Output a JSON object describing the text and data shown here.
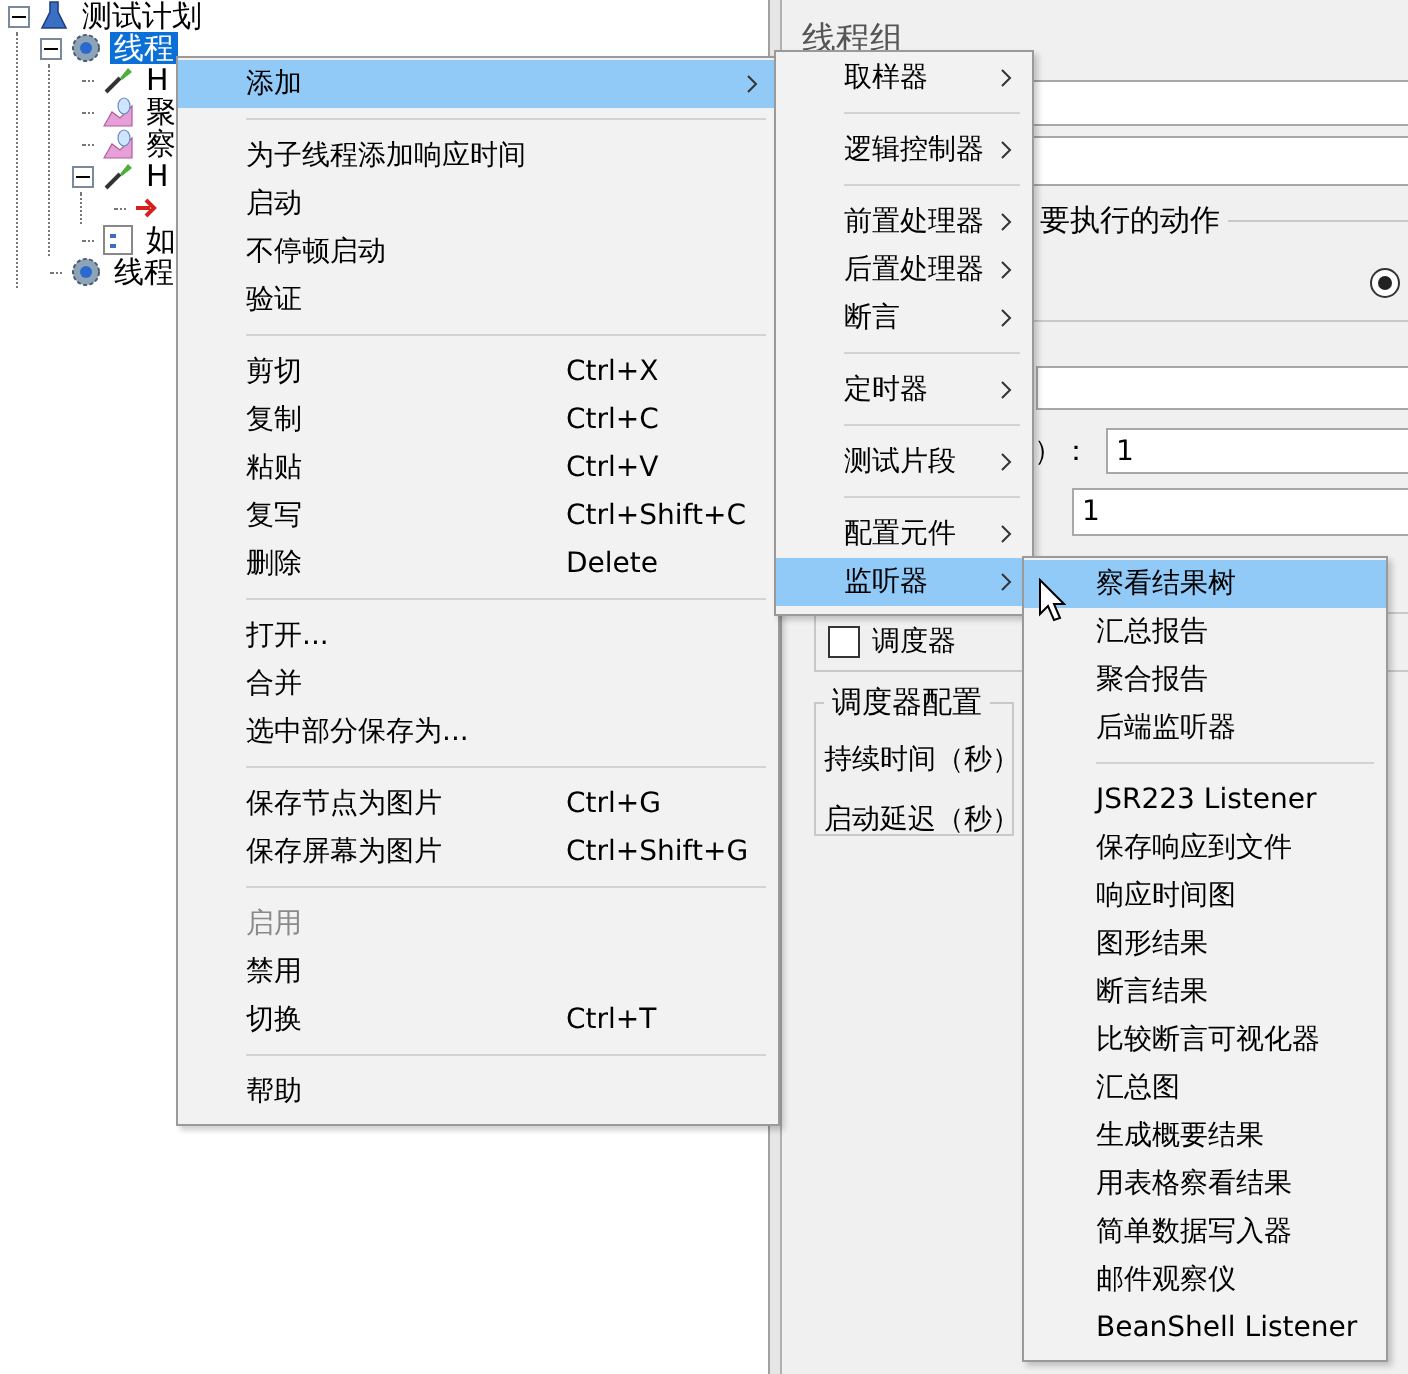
{
  "tree": [
    {
      "label": "测试计划",
      "kind": "plan",
      "selected": false,
      "expanded": true,
      "children": [
        {
          "label": "线程",
          "kind": "thread_group",
          "selected": true,
          "expanded": true,
          "children": [
            {
              "label": "H",
              "kind": "sampler",
              "selected": false
            },
            {
              "label": "聚",
              "kind": "listener",
              "selected": false
            },
            {
              "label": "察",
              "kind": "listener",
              "selected": false
            },
            {
              "label": "H",
              "kind": "sampler",
              "selected": false,
              "expanded": true,
              "children": [
                {
                  "kind": "modifier",
                  "selected": false
                }
              ]
            },
            {
              "label": "如",
              "kind": "config",
              "selected": false
            }
          ]
        },
        {
          "label": "线程",
          "kind": "thread_group",
          "selected": false
        }
      ]
    }
  ],
  "panel": {
    "title": "线程组",
    "action_legend": "要执行的动作",
    "action_radio": {
      "selected": true
    },
    "count_label": "）：",
    "count_value": "1",
    "loop_value": "1",
    "scheduler": {
      "label": "调度器",
      "checked": false
    },
    "scheduler_config": {
      "legend": "调度器配置",
      "fields": [
        "持续时间（秒）",
        "启动延迟（秒）"
      ]
    }
  },
  "context_menu": {
    "sections": [
      [
        {
          "label": "添加",
          "has_submenu": true,
          "selected": true,
          "disabled": false
        }
      ],
      [
        {
          "label": "为子线程添加响应时间",
          "selected": false,
          "disabled": false
        },
        {
          "label": "启动",
          "selected": false,
          "disabled": false
        },
        {
          "label": "不停顿启动",
          "selected": false,
          "disabled": false
        },
        {
          "label": "验证",
          "selected": false,
          "disabled": false
        }
      ],
      [
        {
          "label": "剪切",
          "shortcut": "Ctrl+X",
          "selected": false,
          "disabled": false
        },
        {
          "label": "复制",
          "shortcut": "Ctrl+C",
          "selected": false,
          "disabled": false
        },
        {
          "label": "粘贴",
          "shortcut": "Ctrl+V",
          "selected": false,
          "disabled": false
        },
        {
          "label": "复写",
          "shortcut": "Ctrl+Shift+C",
          "selected": false,
          "disabled": false
        },
        {
          "label": "删除",
          "shortcut": "Delete",
          "selected": false,
          "disabled": false
        }
      ],
      [
        {
          "label": "打开...",
          "selected": false,
          "disabled": false
        },
        {
          "label": "合并",
          "selected": false,
          "disabled": false
        },
        {
          "label": "选中部分保存为...",
          "selected": false,
          "disabled": false
        }
      ],
      [
        {
          "label": "保存节点为图片",
          "shortcut": "Ctrl+G",
          "selected": false,
          "disabled": false
        },
        {
          "label": "保存屏幕为图片",
          "shortcut": "Ctrl+Shift+G",
          "selected": false,
          "disabled": false
        }
      ],
      [
        {
          "label": "启用",
          "selected": false,
          "disabled": true
        },
        {
          "label": "禁用",
          "selected": false,
          "disabled": false
        },
        {
          "label": "切换",
          "shortcut": "Ctrl+T",
          "selected": false,
          "disabled": false
        }
      ],
      [
        {
          "label": "帮助",
          "selected": false,
          "disabled": false
        }
      ]
    ]
  },
  "add_menu": {
    "sections": [
      [
        {
          "label": "取样器",
          "has_submenu": true,
          "selected": false
        }
      ],
      [
        {
          "label": "逻辑控制器",
          "has_submenu": true,
          "selected": false
        }
      ],
      [
        {
          "label": "前置处理器",
          "has_submenu": true,
          "selected": false
        },
        {
          "label": "后置处理器",
          "has_submenu": true,
          "selected": false
        },
        {
          "label": "断言",
          "has_submenu": true,
          "selected": false
        }
      ],
      [
        {
          "label": "定时器",
          "has_submenu": true,
          "selected": false
        }
      ],
      [
        {
          "label": "测试片段",
          "has_submenu": true,
          "selected": false
        }
      ],
      [
        {
          "label": "配置元件",
          "has_submenu": true,
          "selected": false
        },
        {
          "label": "监听器",
          "has_submenu": true,
          "selected": true
        }
      ]
    ]
  },
  "listener_menu": {
    "sections": [
      [
        {
          "label": "察看结果树",
          "selected": true
        },
        {
          "label": "汇总报告",
          "selected": false
        },
        {
          "label": "聚合报告",
          "selected": false
        },
        {
          "label": "后端监听器",
          "selected": false
        }
      ],
      [
        {
          "label": "JSR223 Listener",
          "selected": false
        },
        {
          "label": "保存响应到文件",
          "selected": false
        },
        {
          "label": "响应时间图",
          "selected": false
        },
        {
          "label": "图形结果",
          "selected": false
        },
        {
          "label": "断言结果",
          "selected": false
        },
        {
          "label": "比较断言可视化器",
          "selected": false
        },
        {
          "label": "汇总图",
          "selected": false
        },
        {
          "label": "生成概要结果",
          "selected": false
        },
        {
          "label": "用表格察看结果",
          "selected": false
        },
        {
          "label": "简单数据写入器",
          "selected": false
        },
        {
          "label": "邮件观察仪",
          "selected": false
        },
        {
          "label": "BeanShell Listener",
          "selected": false
        }
      ]
    ]
  }
}
